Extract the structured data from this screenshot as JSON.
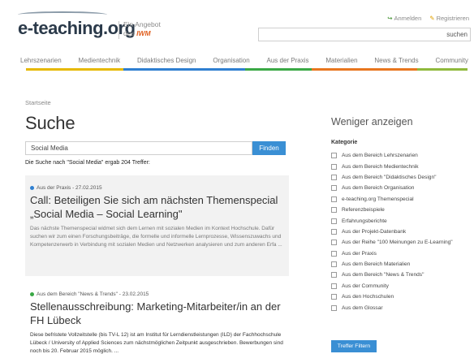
{
  "header": {
    "logo_text": "e-teaching.org",
    "angebot_line1": "Ein Angebot",
    "angebot_prefix": "des",
    "angebot_brand": "IWM",
    "login_label": "Anmelden",
    "register_label": "Registrieren",
    "search_value": "",
    "search_button": "suchen"
  },
  "nav": {
    "items": [
      {
        "label": "Lehrszenarien",
        "color": "#e6b800"
      },
      {
        "label": "Medientechnik",
        "color": "#e6b800"
      },
      {
        "label": "Didaktisches Design",
        "color": "#2f7fd0"
      },
      {
        "label": "Organisation",
        "color": "#2f7fd0"
      },
      {
        "label": "Aus der Praxis",
        "color": "#3aa845"
      },
      {
        "label": "Materialien",
        "color": "#e8761e"
      },
      {
        "label": "News & Trends",
        "color": "#e8761e"
      },
      {
        "label": "Community",
        "color": "#8fb93c"
      }
    ]
  },
  "breadcrumb": "Startseite",
  "page_title": "Suche",
  "search": {
    "value": "Social Media",
    "button": "Finden",
    "result_text": "Die Suche nach \"Social Media\" ergab 204 Treffer:"
  },
  "results": [
    {
      "meta": "Aus der Praxis - 27.02.2015",
      "dot_color": "#2f7fd0",
      "title": "Call: Beteiligen Sie sich am nächsten Themenspecial „Social Media – Social Learning\"",
      "snippet": "Das nächste Themenspecial widmet sich dem Lernen mit sozialen Medien im Kontext Hochschule. Dafür suchen wir zum einen Forschungsbeiträge, die formelle und informelle Lernprozesse, Wissenszuwachs und Kompetenzerwerb in Verbindung mit sozialen Medien und Netzwerken analysieren und zum anderen Erfa ..."
    },
    {
      "meta": "Aus dem Bereich \"News & Trends\" - 23.02.2015",
      "dot_color": "#3aa845",
      "title": "Stellenausschreibung: Marketing-Mitarbeiter/in an der FH Lübeck",
      "snippet": "Diese befristete Vollzeitstelle (bis TV-L 12) ist am Institut für Lerndienstleistungen (ILD) der Fachhochschule Lübeck / University of Applied Sciences zum nächstmöglichen Zeitpunkt ausgeschrieben. Bewerbungen sind noch bis 20. Februar 2015 möglich. ..."
    }
  ],
  "sidebar": {
    "toggle": "Weniger anzeigen",
    "heading": "Kategorie",
    "categories": [
      "Aus dem Bereich Lehrszenarien",
      "Aus dem Bereich Medientechnik",
      "Aus dem Bereich \"Didaktisches Design\"",
      "Aus dem Bereich Organisation",
      "e-teaching.org Themenspecial",
      "Referenzbeispiele",
      "Erfahrungsberichte",
      "Aus der Projekt-Datenbank",
      "Aus der Reihe \"100 Meinungen zu E-Learning\"",
      "Aus der Praxis",
      "Aus dem Bereich Materialien",
      "Aus dem Bereich \"News & Trends\"",
      "Aus der Community",
      "Aus den Hochschulen",
      "Aus dem Glossar"
    ],
    "filter_button": "Treffer Filtern"
  }
}
